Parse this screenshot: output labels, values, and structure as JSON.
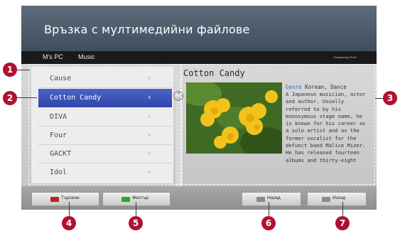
{
  "header": {
    "title": "Връзка с мултимедийни файлове"
  },
  "breadcrumb": {
    "source": "M's PC",
    "category": "Music",
    "powered_by": "Powered by PLAY"
  },
  "list": {
    "items": [
      {
        "label": "Cause",
        "selected": false
      },
      {
        "label": "Cotton Candy",
        "selected": true
      },
      {
        "label": "DIVA",
        "selected": false
      },
      {
        "label": "Four",
        "selected": false
      },
      {
        "label": "GACKT",
        "selected": false
      },
      {
        "label": "Idol",
        "selected": false
      }
    ],
    "chevron": "›",
    "scroll_handle_icon": "⌃"
  },
  "detail": {
    "title": "Cotton Candy",
    "genre_key": "Genre",
    "genre_value": "Korean, Dance",
    "description": "A Japanese musician, actor and author. Usually referred to by his monosymous stage name, he is known for his career as a solo artist and as the former vocalist for the defunct band Malice Mizer. He has released fourteen albums and thirty-eight"
  },
  "buttons": [
    {
      "label": "Търсене",
      "key_color": "#c02020",
      "key_icon": "red-key-icon"
    },
    {
      "label": "Филтър",
      "key_color": "#2aa52a",
      "key_icon": "green-key-icon"
    },
    {
      "label": "Назад",
      "key_color": "#8a8a8a",
      "key_icon": "back-key-icon"
    },
    {
      "label": "Изход",
      "key_color": "#8a8a8a",
      "key_icon": "exit-key-icon"
    }
  ],
  "callouts": [
    "1",
    "2",
    "3",
    "4",
    "5",
    "6",
    "7"
  ],
  "colors": {
    "callout": "#b0122e",
    "selection": "#3a52b8",
    "title_bar": "#4d5c6b"
  }
}
